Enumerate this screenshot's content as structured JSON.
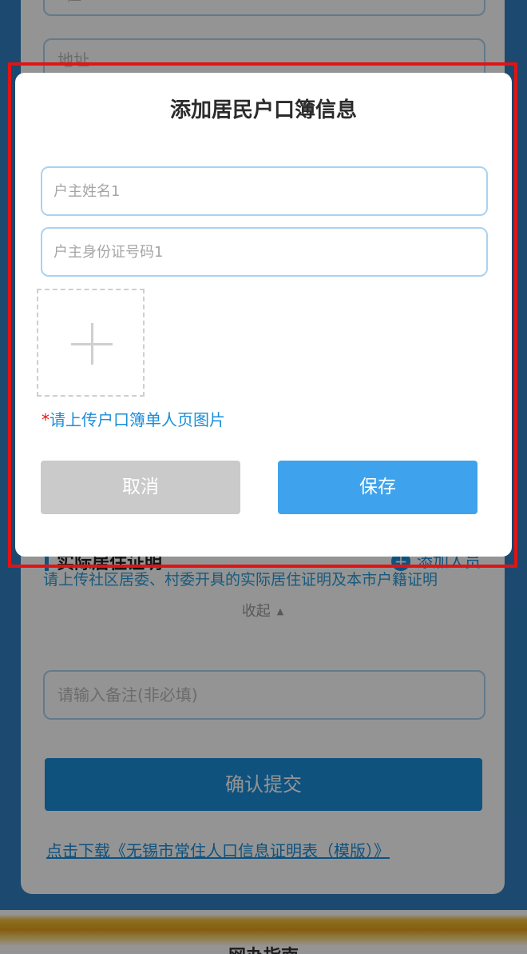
{
  "background": {
    "fields": [
      {
        "placeholder": "*住"
      },
      {
        "placeholder": "地址"
      }
    ],
    "section_title": "实际居住证明",
    "add_label": "添加人员",
    "hint": "请上传社区居委、村委开具的实际居住证明及本市户籍证明",
    "collapse_label": "收起",
    "remark_placeholder": "请输入备注(非必填)",
    "submit_label": "确认提交",
    "download_link": "点击下载《无锡市常住人口信息证明表（模版）》",
    "footer_text": "网办指南"
  },
  "dialog": {
    "title": "添加居民户口簿信息",
    "name_placeholder": "户主姓名1",
    "id_placeholder": "户主身份证号码1",
    "upload_required_mark": "*",
    "upload_hint": "请上传户口簿单人页图片",
    "cancel_label": "取消",
    "save_label": "保存"
  },
  "colors": {
    "accent": "#1a8dd9",
    "save_button": "#3ea3ec",
    "cancel_button": "#cacaca",
    "highlight_border": "#e01414"
  },
  "icons": {
    "upload": "plus-icon",
    "add": "plus-circle-icon",
    "collapse": "triangle-up-icon"
  }
}
